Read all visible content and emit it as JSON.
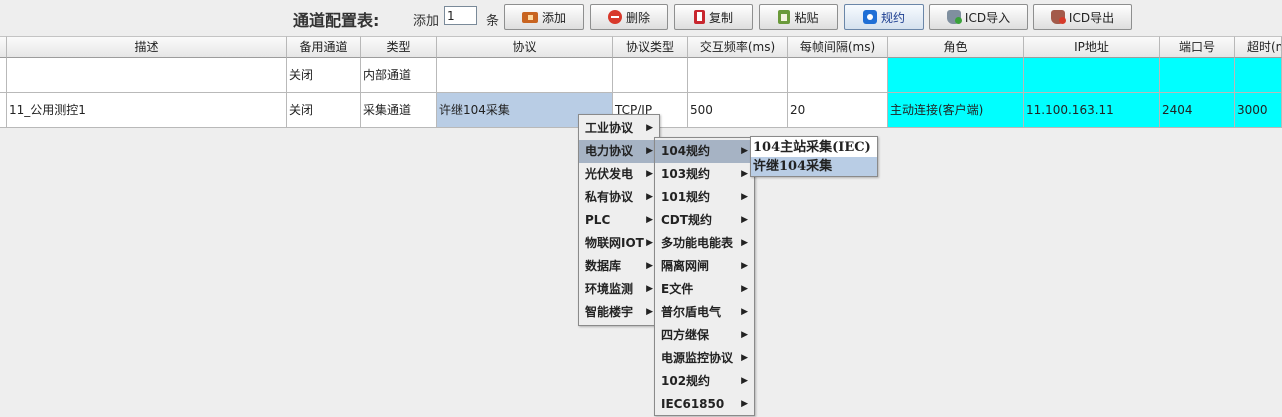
{
  "toolbar": {
    "title": "通道配置表:",
    "add_prefix": "添加",
    "add_count": "1",
    "add_suffix": "条",
    "buttons": {
      "add": "添加",
      "delete": "删除",
      "copy": "复制",
      "paste": "粘贴",
      "rule": "规约",
      "icd_import": "ICD导入",
      "icd_export": "ICD导出"
    }
  },
  "table": {
    "headers": [
      "描述",
      "备用通道",
      "类型",
      "协议",
      "协议类型",
      "交互频率(ms)",
      "每帧间隔(ms)",
      "角色",
      "IP地址",
      "端口号",
      "超时(m"
    ],
    "rows": [
      [
        "",
        "关闭",
        "内部通道",
        "",
        "",
        "",
        "",
        "",
        "",
        "",
        ""
      ],
      [
        "11_公用测控1",
        "关闭",
        "采集通道",
        "许继104采集",
        "TCP/IP",
        "500",
        "20",
        "主动连接(客户端)",
        "11.100.163.11",
        "2404",
        "3000"
      ]
    ]
  },
  "menus": {
    "level1": [
      "工业协议",
      "电力协议",
      "光伏发电",
      "私有协议",
      "PLC",
      "物联网IOT",
      "数据库",
      "环境监测",
      "智能楼宇"
    ],
    "level2": [
      "104规约",
      "103规约",
      "101规约",
      "CDT规约",
      "多功能电能表",
      "隔离网闸",
      "E文件",
      "普尔盾电气",
      "四方继保",
      "电源监控协议",
      "102规约",
      "IEC61850"
    ],
    "level3": [
      "104主站采集(IEC)",
      "许继104采集"
    ]
  },
  "colors": {
    "cyan_cells": "#00ffff",
    "selected_cell": "#b9cde5",
    "menu_highlight": "#a6b3c4"
  }
}
